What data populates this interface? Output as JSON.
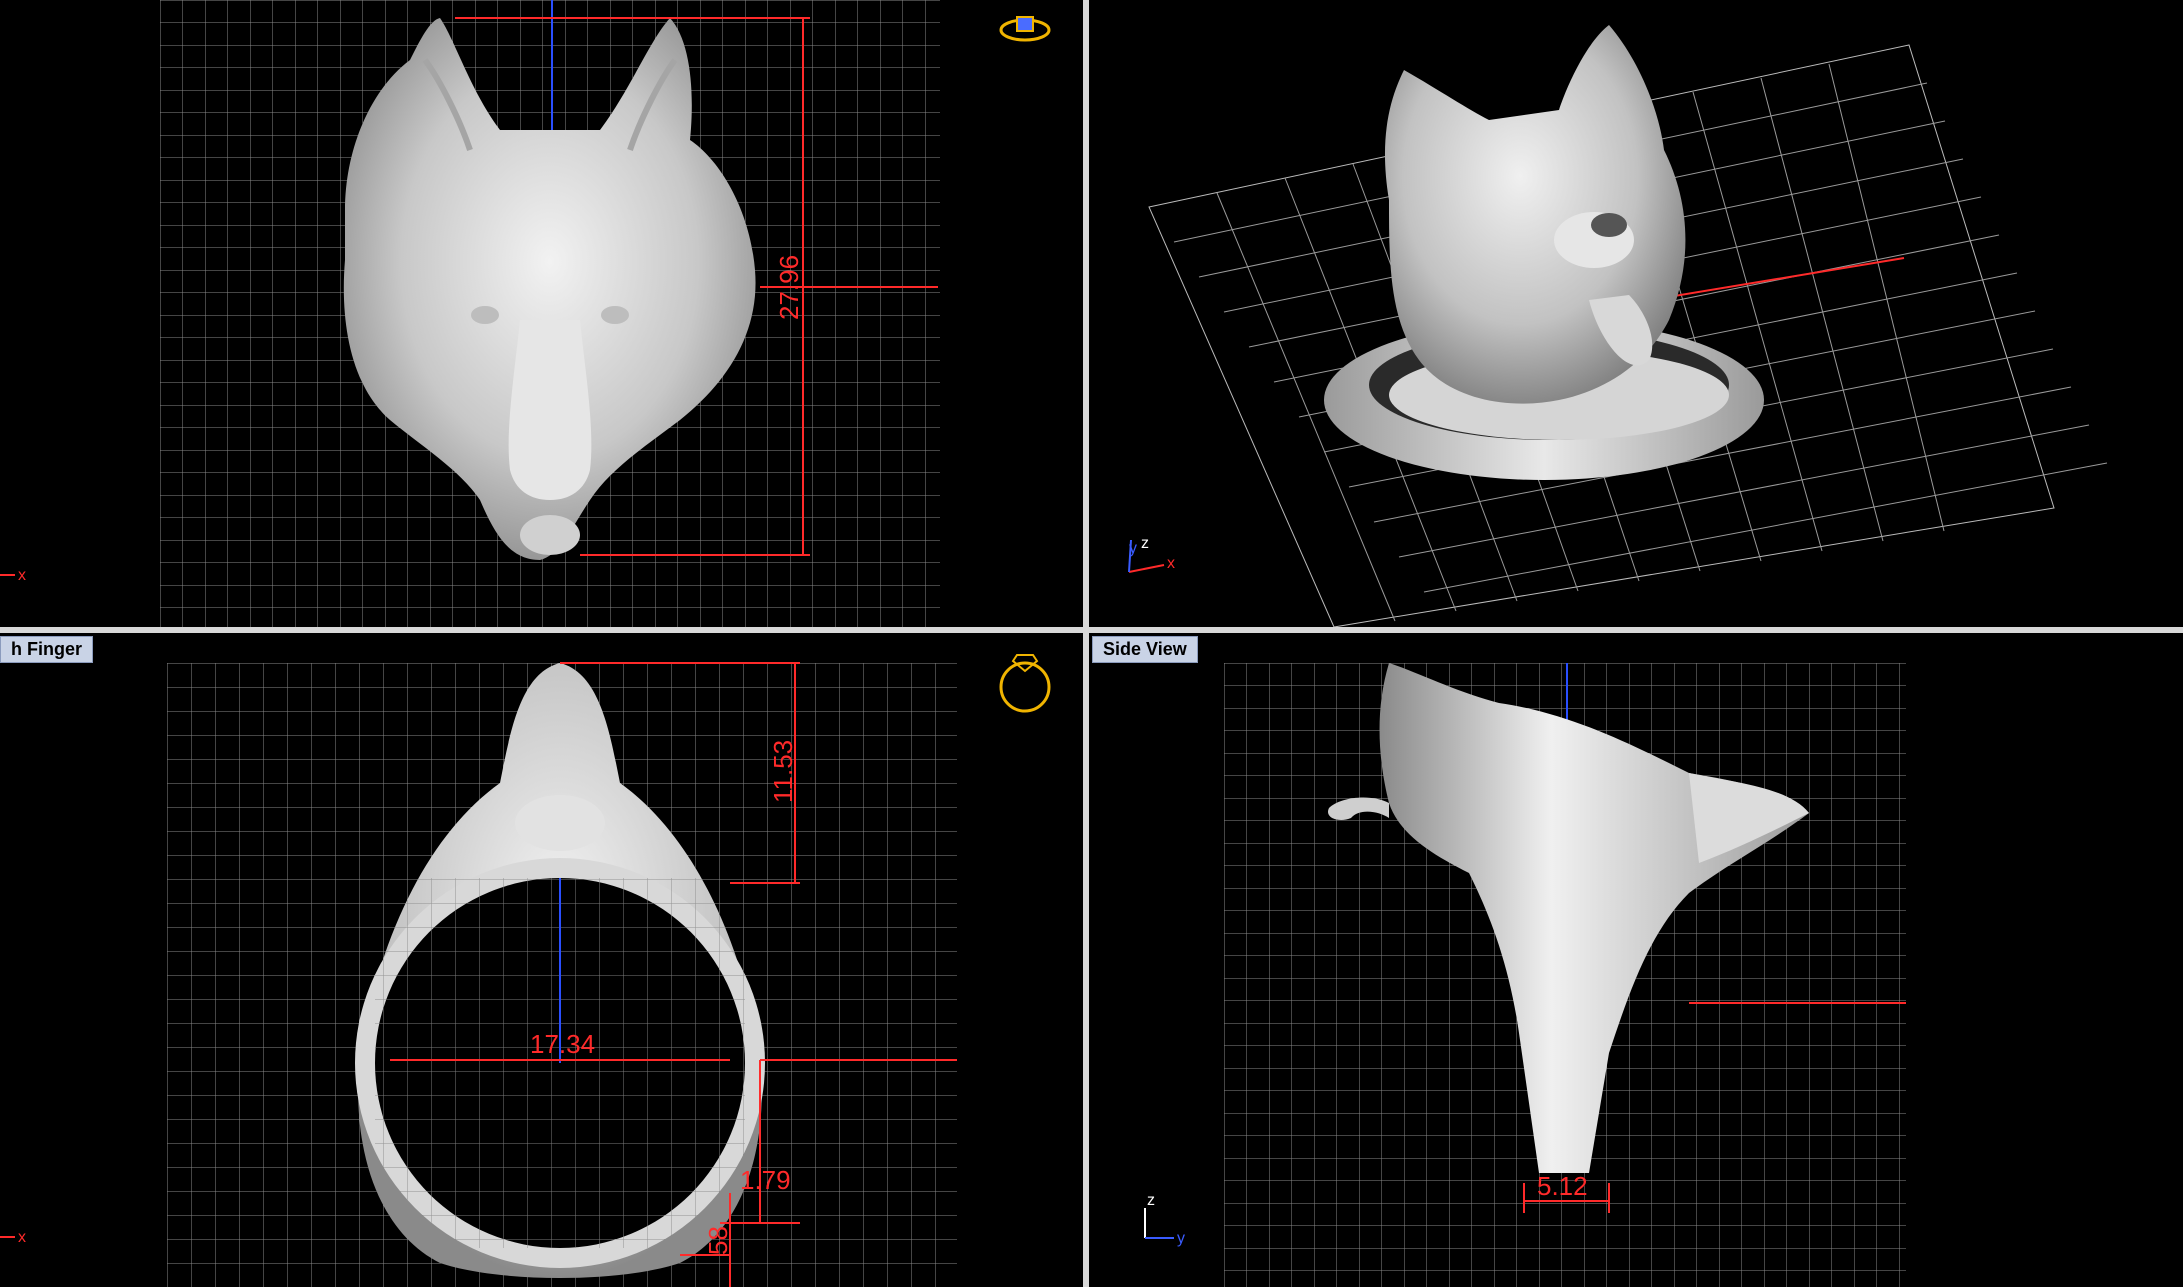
{
  "viewports": {
    "front": {
      "label": "",
      "dimension_height": "27.96",
      "axis_x": "x"
    },
    "perspective": {
      "label": "",
      "axis_x": "x",
      "axis_y": "y",
      "axis_z": "z"
    },
    "finger": {
      "label": "h Finger",
      "dimension_inner": "17.34",
      "dimension_top": "11.53",
      "dimension_band": "1.79",
      "dimension_bottom": "58",
      "axis_x": "x"
    },
    "side": {
      "label": "Side View",
      "dimension_width": "5.12",
      "axis_z": "z",
      "axis_y": "y"
    }
  },
  "colors": {
    "grid": "#a0a0a0",
    "dimension": "#ff2a2a",
    "background": "#000000",
    "divider": "#d8d8d8",
    "model": "#d9d9d9",
    "label_bg": "#c9d3e6"
  },
  "icons": [
    "ring-icon"
  ]
}
